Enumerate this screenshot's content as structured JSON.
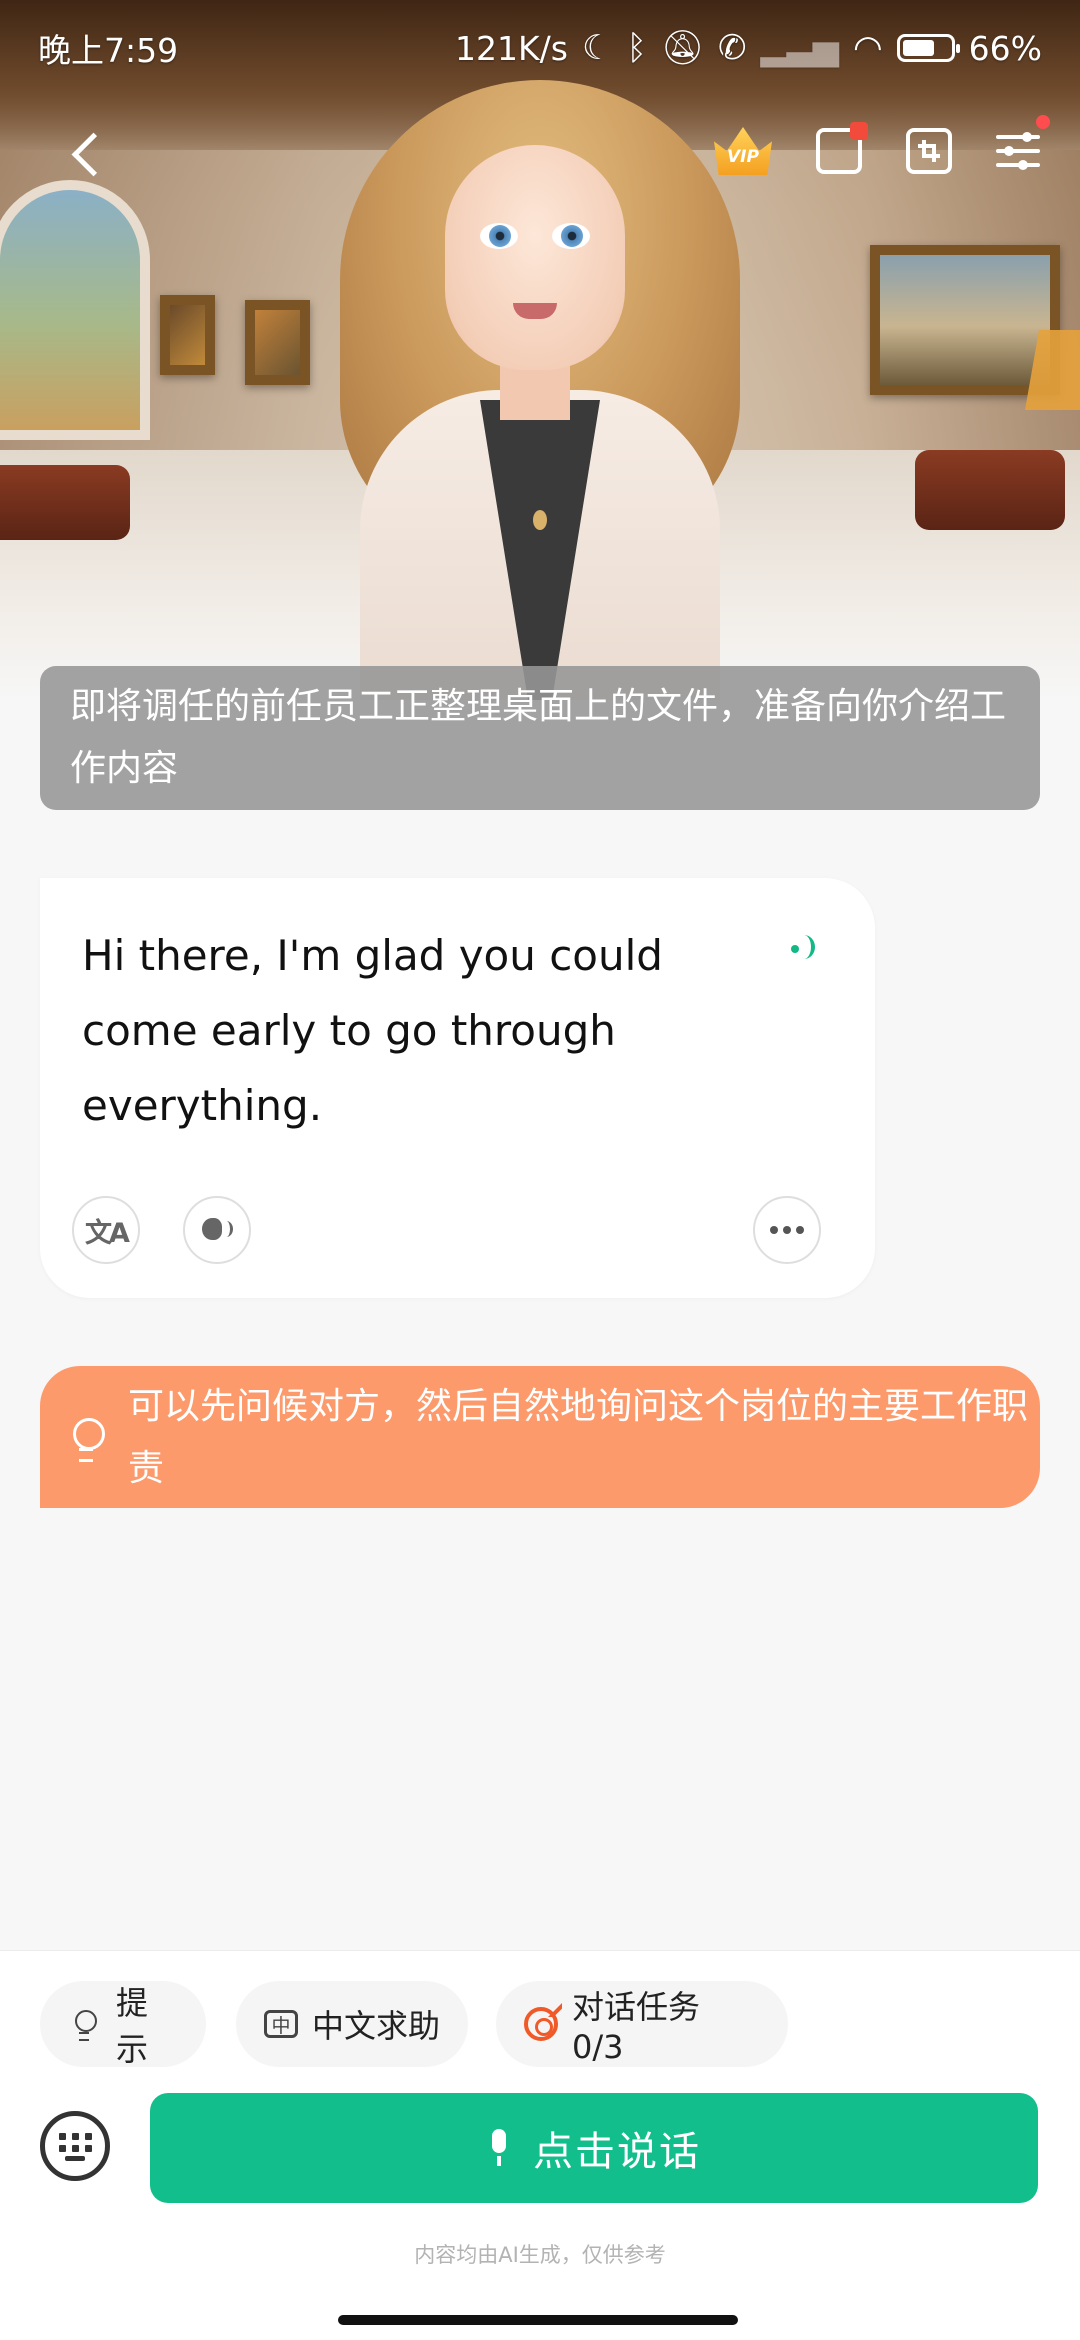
{
  "status_bar": {
    "time": "晚上7:59",
    "net_speed": "121K/s",
    "battery": "66%"
  },
  "top_bar": {
    "vip_label": "VIP",
    "icons": [
      "back-icon",
      "vip-crown-icon",
      "share-icon",
      "shrink-icon",
      "settings-icon"
    ]
  },
  "scene": {
    "caption": "即将调任的前任员工正整理桌面上的文件，准备向你介绍工作内容"
  },
  "ai_message": {
    "text": "Hi there, I'm glad you could come early to go through everything.",
    "actions": [
      "translate-icon",
      "voice-icon",
      "more-icon"
    ]
  },
  "hint": {
    "text": "可以先问候对方，然后自然地询问这个岗位的主要工作职责"
  },
  "toolbar": {
    "hint_label": "提示",
    "cn_help_label": "中文求助",
    "task_label": "对话任务 0/3"
  },
  "talk_button": {
    "label": "点击说话"
  },
  "disclaimer": "内容均由AI生成，仅供参考",
  "colors": {
    "accent_green": "#12bf8c",
    "hint_orange": "#fd9a6c",
    "task_red": "#f05a28",
    "caption_gray": "#969696"
  }
}
